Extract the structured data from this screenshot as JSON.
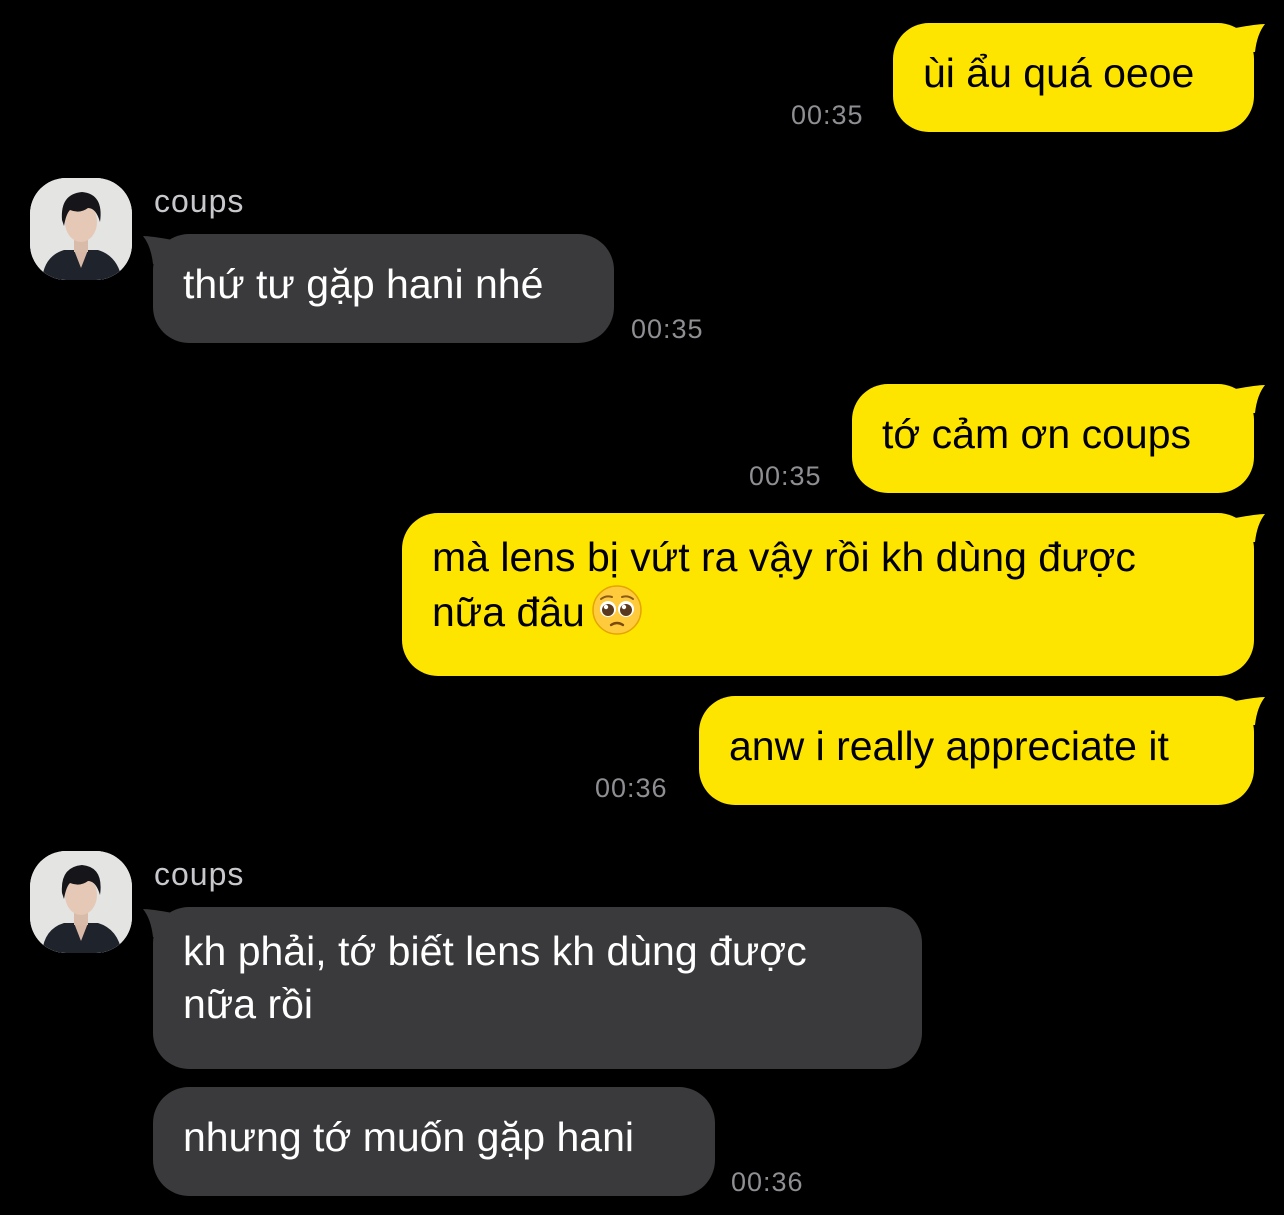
{
  "chat": {
    "messages": [
      {
        "text": "ùi ẩu quá oeoe",
        "time": "00:35"
      },
      {
        "sender": "coups",
        "text": "thứ tư gặp hani nhé",
        "time": "00:35"
      },
      {
        "text": "tớ cảm ơn coups",
        "time": "00:35"
      },
      {
        "text_line1": "mà lens bị vứt ra vậy rồi kh dùng được",
        "text_line2": "nữa đâu",
        "emoji": "pleading-face-emoji"
      },
      {
        "text": "anw i really appreciate it",
        "time": "00:36"
      },
      {
        "sender": "coups",
        "text_line1": "kh phải, tớ biết lens kh dùng được",
        "text_line2": "nữa rồi"
      },
      {
        "text": "nhưng tớ muốn gặp hani",
        "time": "00:36"
      }
    ]
  },
  "colors": {
    "background": "#000000",
    "my_bubble": "#FEE500",
    "their_bubble": "#3A3A3C",
    "timestamp": "#8E8E93"
  }
}
